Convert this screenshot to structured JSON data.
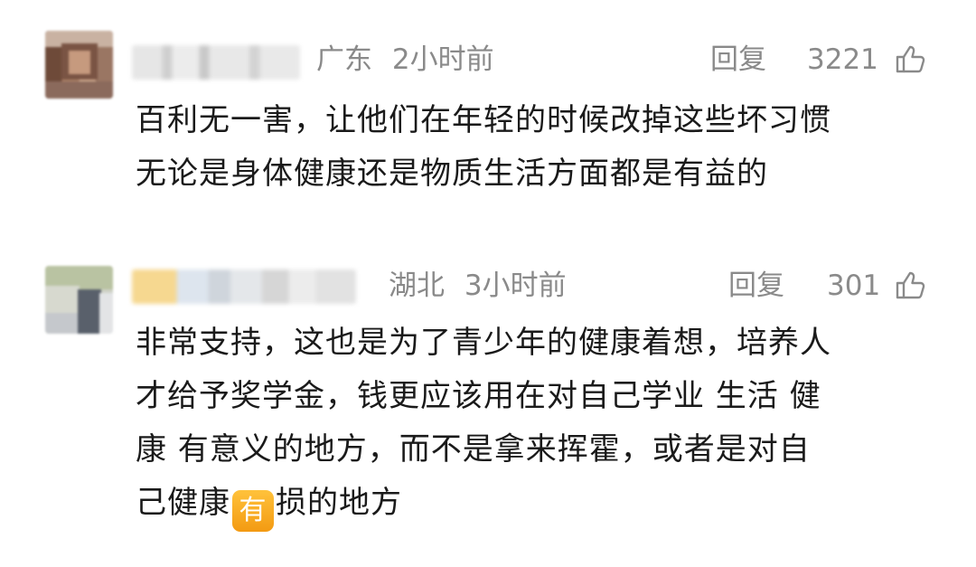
{
  "comments": [
    {
      "region": "广东",
      "time": "2小时前",
      "reply_label": "回复",
      "likes": "3221",
      "like_icon": "thumbs-up-outline",
      "body_lines": [
        "百利无一害，让他们在年轻的时候改掉这些坏习惯",
        "无论是身体健康还是物质生活方面都是有益的"
      ]
    },
    {
      "region": "湖北",
      "time": "3小时前",
      "reply_label": "回复",
      "likes": "301",
      "like_icon": "thumbs-up-outline",
      "body_lines": [
        "非常支持，这也是为了青少年的健康着想，培养人",
        "才给予奖学金，钱更应该用在对自己学业 生活 健",
        "康 有意义的地方，而不是拿来挥霍，或者是对自"
      ],
      "body_last_prefix": "己健康",
      "emoji_char": "有",
      "body_last_suffix": "损的地方"
    }
  ],
  "colors": {
    "text": "#1a1a1a",
    "meta": "#8a8a8a",
    "emoji_bg": "#f7a823"
  }
}
